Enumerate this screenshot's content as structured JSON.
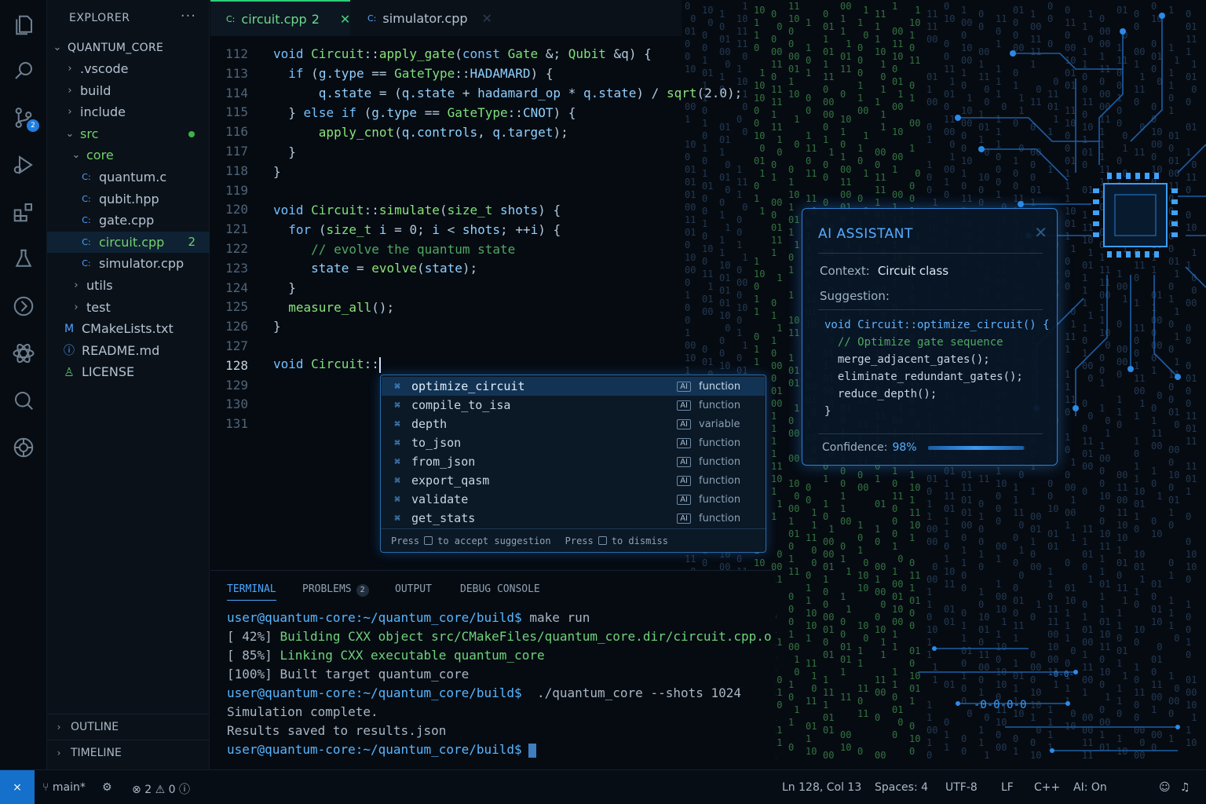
{
  "explorer": {
    "header": "EXPLORER",
    "more": "···",
    "project": "QUANTUM_CORE",
    "items": [
      {
        "label": ".vscode",
        "type": "folder",
        "open": false,
        "depth": 1
      },
      {
        "label": "build",
        "type": "folder",
        "open": false,
        "depth": 1
      },
      {
        "label": "include",
        "type": "folder",
        "open": false,
        "depth": 1
      },
      {
        "label": "src",
        "type": "folder",
        "open": true,
        "depth": 1
      },
      {
        "label": "core",
        "type": "folder",
        "open": true,
        "depth": 2
      },
      {
        "label": "quantum.c",
        "type": "file",
        "depth": 3
      },
      {
        "label": "qubit.hpp",
        "type": "file",
        "depth": 3
      },
      {
        "label": "gate.cpp",
        "type": "file",
        "depth": 3
      },
      {
        "label": "circuit.cpp",
        "type": "file",
        "depth": 3,
        "badge": "2"
      },
      {
        "label": "simulator.cpp",
        "type": "file",
        "depth": 3
      },
      {
        "label": "utils",
        "type": "folder",
        "open": false,
        "depth": 2
      },
      {
        "label": "test",
        "type": "folder",
        "open": false,
        "depth": 2
      },
      {
        "label": "CMakeLists.txt",
        "type": "file",
        "icon": "M",
        "depth": 1
      },
      {
        "label": "README.md",
        "type": "file",
        "icon": "info",
        "depth": 1
      },
      {
        "label": "LICENSE",
        "type": "file",
        "icon": "license",
        "depth": 1
      }
    ],
    "outline": "OUTLINE",
    "timeline": "TIMELINE"
  },
  "activity": {
    "items": [
      "files-icon",
      "search-icon",
      "source-control-icon",
      "run-debug-icon",
      "extensions-icon",
      "testing-icon",
      "remote-icon",
      "atom-icon",
      "search-zoom-icon",
      "accounts-icon"
    ],
    "scm_badge": "2"
  },
  "tabs": [
    {
      "label": "circuit.cpp",
      "badge": "2",
      "active": true
    },
    {
      "label": "simulator.cpp",
      "active": false
    }
  ],
  "editor": {
    "line_numbers": [
      "112",
      "113",
      "114",
      "115",
      "116",
      "117",
      "118",
      "119",
      "120",
      "121",
      "122",
      "123",
      "124",
      "125",
      "126",
      "127",
      "128",
      "129",
      "130",
      "131"
    ],
    "current_line": "128"
  },
  "autocomplete": {
    "items": [
      {
        "label": "optimize_circuit",
        "tag": "AI",
        "kind": "function"
      },
      {
        "label": "compile_to_isa",
        "tag": "AI",
        "kind": "function"
      },
      {
        "label": "depth",
        "tag": "AI",
        "kind": "variable"
      },
      {
        "label": "to_json",
        "tag": "AI",
        "kind": "function"
      },
      {
        "label": "from_json",
        "tag": "AI",
        "kind": "function"
      },
      {
        "label": "export_qasm",
        "tag": "AI",
        "kind": "function"
      },
      {
        "label": "validate",
        "tag": "AI",
        "kind": "function"
      },
      {
        "label": "get_stats",
        "tag": "AI",
        "kind": "function"
      }
    ],
    "footer_press": "Press",
    "footer_accept": "to accept suggestion",
    "footer_dismiss": "to dismiss"
  },
  "ai_panel": {
    "title": "AI ASSISTANT",
    "context_label": "Context:",
    "context_value": "Circuit class",
    "suggestion_label": "Suggestion:",
    "code": [
      "void Circuit::optimize_circuit() {",
      "  // Optimize gate sequence",
      "  merge_adjacent_gates();",
      "  eliminate_redundant_gates();",
      "  reduce_depth();",
      "}"
    ],
    "confidence_label": "Confidence:",
    "confidence_value": "98%",
    "confidence_fraction": 0.98
  },
  "terminal": {
    "tabs": [
      {
        "label": "TERMINAL",
        "active": true
      },
      {
        "label": "PROBLEMS",
        "badge": "2"
      },
      {
        "label": "OUTPUT"
      },
      {
        "label": "DEBUG CONSOLE"
      }
    ],
    "prompt": "user@quantum-core:~/quantum_core/build$",
    "lines": [
      {
        "prompt": true,
        "text": " make run"
      },
      {
        "prefix": "[ 42%] ",
        "text": "Building CXX object src/CMakeFiles/quantum_core.dir/circuit.cpp.o",
        "color": "green"
      },
      {
        "prefix": "[ 85%] ",
        "text": "Linking CXX executable quantum_core",
        "color": "green"
      },
      {
        "prefix": "[100%] ",
        "text": "Built target quantum_core"
      },
      {
        "prompt": true,
        "text": "  ./quantum_core --shots 1024"
      },
      {
        "text": "Simulation complete."
      },
      {
        "text": "Results saved to results.json"
      },
      {
        "prompt": true,
        "text": ""
      }
    ]
  },
  "status_bar": {
    "branch": "main*",
    "errors": "2",
    "warnings": "0",
    "info": "0",
    "position": "Ln 128, Col 13",
    "spaces": "Spaces: 4",
    "encoding": "UTF-8",
    "eol": "LF",
    "language": "C++",
    "ai": "AI: On"
  },
  "colors": {
    "accent": "#1f7ee0",
    "ai_glow": "#2e7fd4",
    "tab_active": "#2bd07a"
  }
}
